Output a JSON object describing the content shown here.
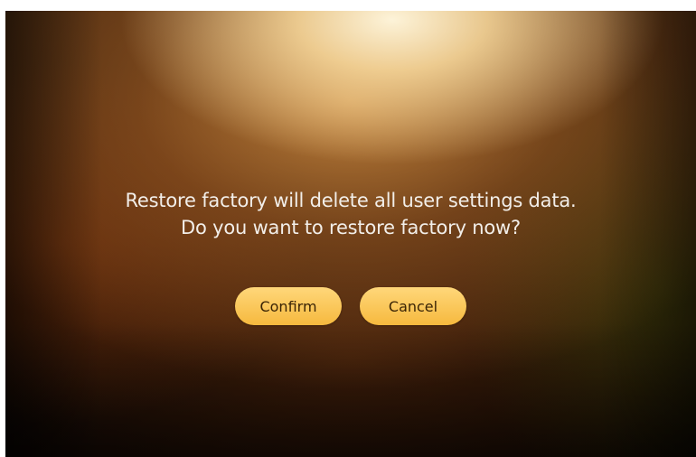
{
  "dialog": {
    "message_line1": "Restore factory will delete all user settings data.",
    "message_line2": "Do you want to restore factory now?",
    "confirm_label": "Confirm",
    "cancel_label": "Cancel"
  },
  "colors": {
    "button_top": "#ffd77a",
    "button_bottom": "#f6b93e",
    "button_text": "#3a2405",
    "message_text": "#f2eee9"
  }
}
